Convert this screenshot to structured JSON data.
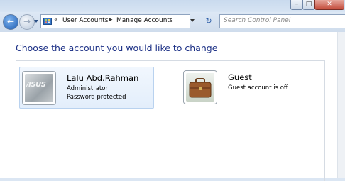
{
  "window": {
    "minimize_glyph": "–",
    "maximize_glyph": "□",
    "close_glyph": "✕"
  },
  "nav": {
    "back_glyph": "←",
    "forward_glyph": "→",
    "overflow_glyph": "«",
    "separator_glyph": "▸",
    "breadcrumbs": [
      "User Accounts",
      "Manage Accounts"
    ],
    "refresh_glyph": "↻",
    "search_placeholder": "Search Control Panel"
  },
  "main": {
    "heading": "Choose the account you would like to change",
    "accounts": [
      {
        "name": "Lalu Abd.Rahman",
        "line1": "Administrator",
        "line2": "Password protected",
        "avatar_logo": "/ISUS",
        "avatar_icon": "asus-logo-icon",
        "selected": true
      },
      {
        "name": "Guest",
        "line1": "Guest account is off",
        "line2": "",
        "avatar_icon": "briefcase-icon",
        "selected": false
      }
    ]
  },
  "colors": {
    "heading": "#1e3287",
    "selection_border": "#b9d2ef",
    "selection_fill": "#e3eefb"
  }
}
